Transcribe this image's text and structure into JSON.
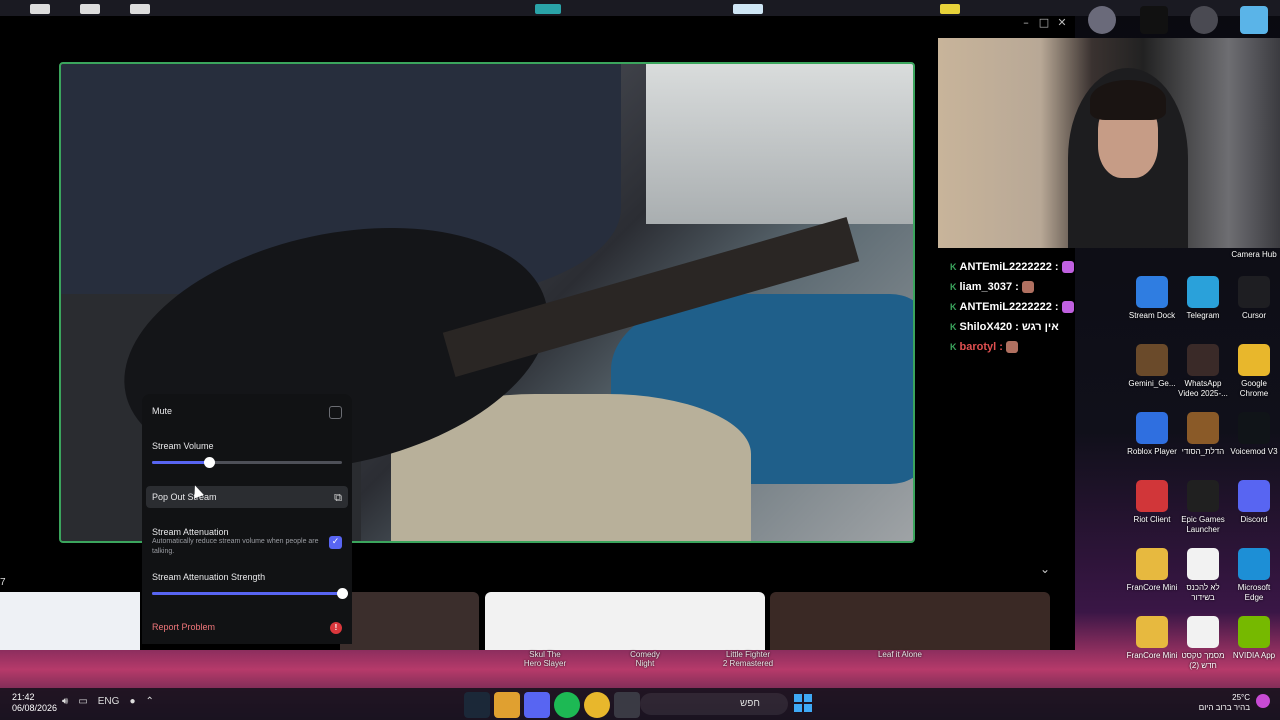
{
  "window_controls": {
    "minimize": "–",
    "maximize": "□",
    "close": "✕"
  },
  "context_menu": {
    "mute_label": "Mute",
    "volume_label": "Stream Volume",
    "volume_value": 0.3,
    "popout_label": "Pop Out Stream",
    "attenuation_label": "Stream Attenuation",
    "attenuation_desc": "Automatically reduce stream volume when people are talking.",
    "attenuation_enabled": true,
    "attenuation_strength_label": "Stream Attenuation Strength",
    "attenuation_strength_value": 1.0,
    "report_label": "Report Problem",
    "report_icon": "!",
    "popout_icon": "⧉",
    "check_glyph": "✓"
  },
  "left_marker": "7",
  "chevron": "⌄",
  "thumb_labels": [
    "Skul The\nHero Slayer",
    "Comedy\nNight",
    "Little Fighter\n2 Remastered",
    "Leaf it Alone"
  ],
  "chat": [
    {
      "user": "ANTEmiL2222222 :",
      "emote": "purple"
    },
    {
      "user": "liam_3037 :",
      "emote": "face"
    },
    {
      "user": "ANTEmiL2222222 :",
      "emote": "purple"
    },
    {
      "user": "ShiloX420 : אין רגש",
      "emote": ""
    },
    {
      "user": "barotyl :",
      "emote": "face",
      "color": "#e05050"
    }
  ],
  "desktop_icons": [
    {
      "label": "Camera Hub",
      "color": "#2a2a30"
    },
    {
      "label": "Stream Dock",
      "color": "#2f7de1"
    },
    {
      "label": "Telegram",
      "color": "#2aa1da"
    },
    {
      "label": "Cursor",
      "color": "#1e1e22"
    },
    {
      "label": "Gemini_Ge...",
      "color": "#6a4a2a"
    },
    {
      "label": "WhatsApp Video 2025-...",
      "color": "#3a2a28"
    },
    {
      "label": "Google Chrome",
      "color": "#e8b72c"
    },
    {
      "label": "Roblox Player",
      "color": "#2f6fe0"
    },
    {
      "label": "הדלת_הסודי",
      "color": "#8a5a28"
    },
    {
      "label": "Voicemod V3",
      "color": "#101418"
    },
    {
      "label": "Riot Client",
      "color": "#d13639"
    },
    {
      "label": "Epic Games Launcher",
      "color": "#202020"
    },
    {
      "label": "Discord",
      "color": "#5865f2"
    },
    {
      "label": "FranCore Mini",
      "color": "#e7b93f"
    },
    {
      "label": "לא להכנס בשידור",
      "color": "#f2f2f2"
    },
    {
      "label": "Microsoft Edge",
      "color": "#1d8fd6"
    },
    {
      "label": "FranCore Mini",
      "color": "#e7b93f"
    },
    {
      "label": "מסמך טקסט חדש (2)",
      "color": "#f2f2f2"
    },
    {
      "label": "NVIDIA App",
      "color": "#76b900"
    }
  ],
  "taskbar": {
    "time": "21:42",
    "date": "06/08/2026",
    "lang": "ENG",
    "search_placeholder": "חפש",
    "weather_temp": "25°C",
    "weather_desc": "בהיר ברוב היום"
  }
}
